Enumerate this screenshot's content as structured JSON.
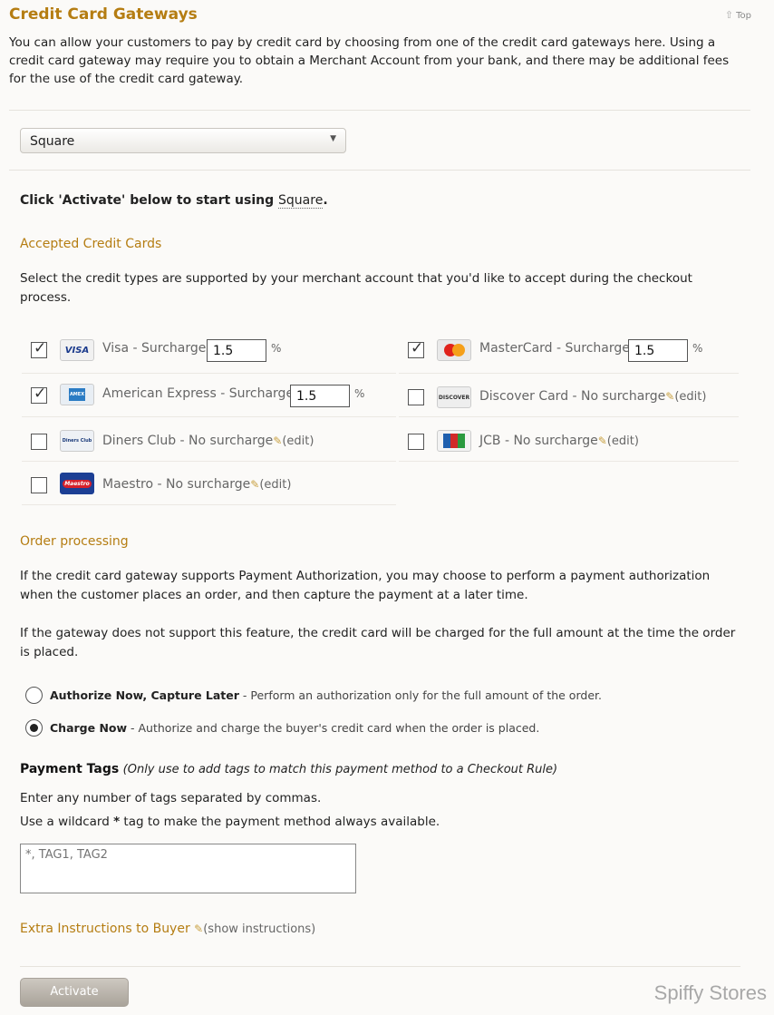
{
  "header": {
    "title": "Credit Card Gateways",
    "top_link": "Top",
    "intro": "You can allow your customers to pay by credit card by choosing from one of the credit card gateways here. Using a credit card gateway may require you to obtain a Merchant Account from your bank, and there may be additional fees for the use of the credit card gateway."
  },
  "gateway": {
    "selected": "Square",
    "activate_prefix": "Click 'Activate' below to start using ",
    "activate_gateway": "Square",
    "activate_suffix": "."
  },
  "accepted_cards": {
    "heading": "Accepted Credit Cards",
    "description": "Select the credit types are supported by your merchant account that you'd like to accept during the checkout process.",
    "cards": [
      {
        "name": "Visa",
        "logo_text": "VISA",
        "checked": true,
        "label": "Visa - Surcharge",
        "surcharge": "1.5",
        "pct": "%"
      },
      {
        "name": "MasterCard",
        "logo_text": "MasterCard",
        "checked": true,
        "label": "MasterCard - Surcharge",
        "surcharge": "1.5",
        "pct": "%"
      },
      {
        "name": "American Express",
        "logo_text": "AMEX",
        "checked": true,
        "label": "American Express - Surcharge",
        "surcharge": "1.5",
        "pct": "%"
      },
      {
        "name": "Discover Card",
        "logo_text": "DISCOVER",
        "checked": false,
        "label": "Discover Card - No surcharge",
        "edit": "(edit)"
      },
      {
        "name": "Diners Club",
        "logo_text": "Diners Club",
        "checked": false,
        "label": "Diners Club - No surcharge",
        "edit": "(edit)"
      },
      {
        "name": "JCB",
        "logo_text": "JCB",
        "checked": false,
        "label": "JCB - No surcharge",
        "edit": "(edit)"
      },
      {
        "name": "Maestro",
        "logo_text": "Maestro",
        "checked": false,
        "label": "Maestro - No surcharge",
        "edit": "(edit)"
      }
    ]
  },
  "order_processing": {
    "heading": "Order processing",
    "para1": "If the credit card gateway supports Payment Authorization, you may choose to perform a payment authorization when the customer places an order, and then capture the payment at a later time.",
    "para2": "If the gateway does not support this feature, the credit card will be charged for the full amount at the time the order is placed.",
    "options": [
      {
        "label": "Authorize Now, Capture Later",
        "description": " - Perform an authorization only for the full amount of the order.",
        "selected": false
      },
      {
        "label": "Charge Now",
        "description": " - Authorize and charge the buyer's credit card when the order is placed.",
        "selected": true
      }
    ]
  },
  "payment_tags": {
    "title": "Payment Tags",
    "note": "(Only use to add tags to match this payment method to a Checkout Rule)",
    "line1": "Enter any number of tags separated by commas.",
    "line2_prefix": "Use a wildcard ",
    "line2_star": "*",
    "line2_suffix": " tag to make the payment method always available.",
    "placeholder": "*, TAG1, TAG2"
  },
  "extra_instructions": {
    "label": "Extra Instructions to Buyer",
    "toggle": "(show instructions)"
  },
  "footer": {
    "activate_label": "Activate",
    "brand": "Spiffy Stores"
  },
  "colors": {
    "accent": "#b57d12",
    "background": "#fbfaf8"
  }
}
